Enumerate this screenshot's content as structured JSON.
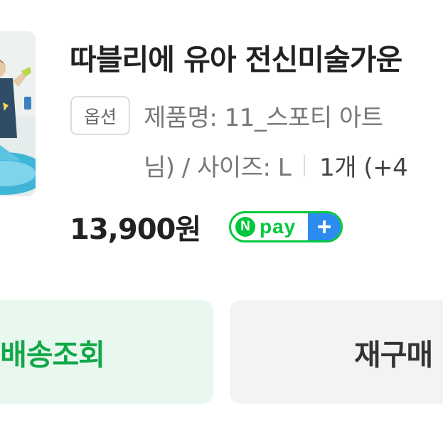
{
  "product": {
    "title": "따블리에 유아 전신미술가운",
    "thumbnail_icon": "product-photo"
  },
  "option": {
    "badge_label": "옵션",
    "line1": "제품명: 11_스포티 아트",
    "line2_prefix": "님) / 사이즈: L",
    "quantity": "1개 (+4"
  },
  "price": {
    "amount": "13,900원",
    "npay_n": "N",
    "npay_label": "pay",
    "npay_plus_icon": "plus-icon"
  },
  "actions": {
    "track_label": "배송조회",
    "rebuy_label": "재구매"
  },
  "colors": {
    "npay_green": "#00c73c",
    "npay_blue": "#2c8bef",
    "track_bg": "#e9f8ee",
    "track_text": "#12a84a",
    "rebuy_bg": "#f2f3f5"
  }
}
